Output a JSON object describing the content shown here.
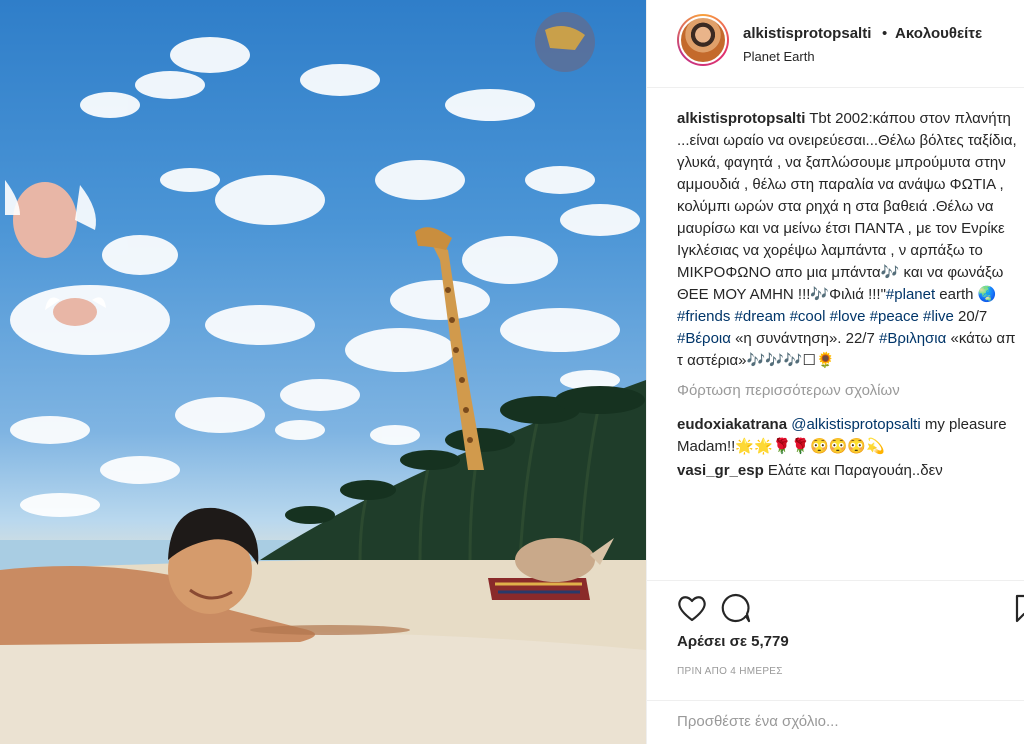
{
  "header": {
    "username": "alkistisprotopsalti",
    "separator": "•",
    "follow_status": "Ακολουθείτε",
    "location": "Planet Earth"
  },
  "caption": {
    "username": "alkistisprotopsalti",
    "text": " Tbt 2002:κάπου στον πλανήτη ...είναι ωραίο να ονειρεύεσαι...Θέλω βόλτες ταξίδια, γλυκά, φαγητά , να ξαπλώσουμε μπρούμυτα στην αμμουδιά , θέλω στη παραλία να ανάψω ΦΩΤΙΑ , κολύμπι ωρών στα ρηχά η στα βαθειά .Θέλω να μαυρίσω και να μείνω έτσι ΠΑΝΤΑ , με τον Ενρίκε Ιγκλέσιας να χορέψω λαμπάντα , ν αρπάξω το ΜΙΚΡΟΦΩΝΟ απο μια μπάντα🎶 και να φωνάξω ΘΕΕ ΜΟΥ ΑΜΗΝ !!!🎶Φιλιά !!!\"",
    "tag_planet": "#planet",
    "text_earth": " earth 🌏 ",
    "tag_friends": "#friends",
    "tag_dream": "#dream",
    "tag_cool": "#cool",
    "tag_love": "#love",
    "tag_peace": "#peace",
    "tag_live": "#live",
    "text_date1": " 20/7 ",
    "tag_veroia": "#Βέροια",
    "text_meeting": " «η συνάντηση». 22/7 ",
    "tag_vrilisia": "#Βριλησια",
    "text_end": " «κάτω απ τ αστέρια»🎶🎶🎶☐🌻"
  },
  "load_more": "Φόρτωση περισσότερων σχολίων",
  "comments": [
    {
      "username": "eudoxiakatrana",
      "mention": "@alkistisprotopsalti",
      "text": " my pleasure Madam!!🌟🌟🌹🌹😳😳😳💫"
    },
    {
      "username": "vasi_gr_esp",
      "text": " Ελάτε και Παραγουάη..δεν"
    }
  ],
  "actions": {
    "likes": "Αρέσει σε 5,779",
    "time": "ΠΡΙΝ ΑΠΟ 4 ΗΜΕΡΕΣ"
  },
  "add_comment": {
    "placeholder": "Προσθέστε ένα σχόλιο..."
  },
  "colors": {
    "link": "#003569",
    "muted": "#999999",
    "text": "#262626",
    "sky": "#3f8bd0",
    "sand": "#e6dcc8"
  },
  "icons": [
    "heart-icon",
    "comment-icon",
    "bookmark-icon"
  ]
}
